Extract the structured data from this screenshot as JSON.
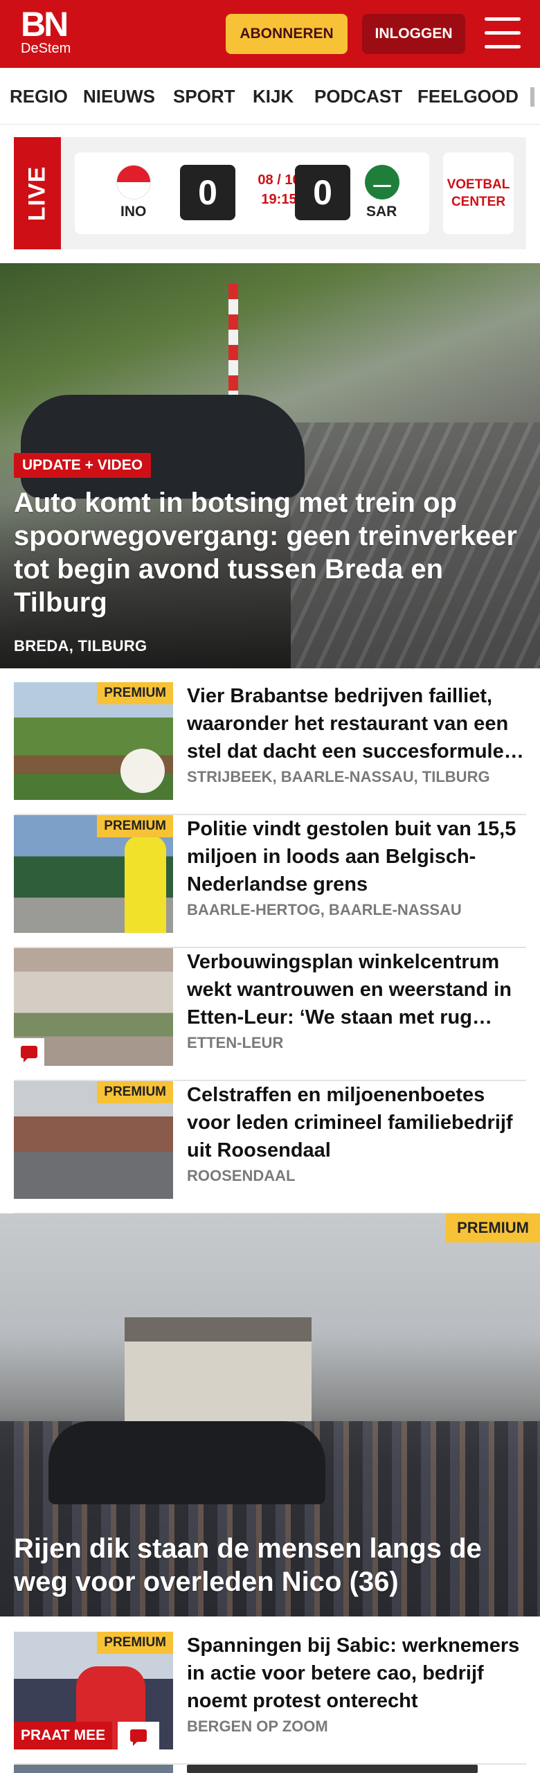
{
  "header": {
    "logo_bn": "BN",
    "logo_sub": "DeStem",
    "subscribe_label": "ABONNEREN",
    "login_label": "INLOGGEN",
    "menu_icon": "hamburger-menu-icon"
  },
  "nav": {
    "items": [
      "REGIO",
      "NIEUWS",
      "SPORT",
      "KIJK",
      "PODCAST",
      "FEELGOOD"
    ]
  },
  "live": {
    "label": "LIVE",
    "home_team": "INO",
    "away_team": "SAR",
    "home_score": "0",
    "away_score": "0",
    "date": "08 / 10",
    "time": "19:15",
    "center_line1": "VOETBAL",
    "center_line2": "CENTER"
  },
  "hero": {
    "tag": "UPDATE + VIDEO",
    "title": "Auto komt in botsing met trein op spoorwegovergang: geen treinverkeer tot begin avond tussen Breda en Tilburg",
    "location": "BREDA, TILBURG"
  },
  "articles": [
    {
      "premium": "PREMIUM",
      "title": "Vier Brabantse bedrijven failliet, waaronder het restaurant van een stel dat dacht een succesformule te hebben",
      "location": "STRIJBEEK, BAARLE-NASSAU, TILBURG"
    },
    {
      "premium": "PREMIUM",
      "title": "Politie vindt gestolen buit van 15,5 miljoen in loods aan Bel­gisch-Nederlandse grens",
      "location": "BAARLE-HERTOG, BAARLE-NASSAU"
    },
    {
      "premium": "",
      "title": "Verbouwingsplan winkelcentrum wekt wantrouwen en weerstand in Etten-Leur: ‘We staan met rug tegen de muur’",
      "location": "ETTEN-LEUR"
    },
    {
      "premium": "PREMIUM",
      "title": "Celstraffen en miljoenenboetes voor leden crimineel familiebe­drijf uit Roosendaal",
      "location": "ROOSENDAAL"
    }
  ],
  "hero2": {
    "premium": "PREMIUM",
    "title": "Rijen dik staan de mensen langs de weg voor overleden Nico (36)"
  },
  "article5": {
    "premium": "PREMIUM",
    "praat_mee": "PRAAT MEE",
    "title": "Spanningen bij Sabic: werknemers in actie voor betere cao, bedrijf noemt protest onterecht",
    "location": "BERGEN OP ZOOM"
  },
  "colors": {
    "brand_red": "#cf0f16",
    "premium_yellow": "#f7c236",
    "login_dark_red": "#9c0c12"
  }
}
